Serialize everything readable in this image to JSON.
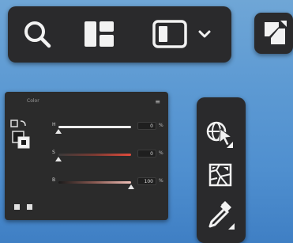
{
  "toolbar": {
    "search_icon": "search-icon",
    "layout_icon": "layout-grid-icon",
    "panel_icon": "panel-view-icon",
    "dropdown_icon": "chevron-down-icon"
  },
  "float_button": {
    "icon": "swap-color-icon"
  },
  "color_panel": {
    "title": "Color",
    "menu_glyph": "≡",
    "rows": [
      {
        "label": "H",
        "value": "0",
        "unit": "%",
        "level": 0.0
      },
      {
        "label": "S",
        "value": "0",
        "unit": "%",
        "level": 0.0
      },
      {
        "label": "B",
        "value": "100",
        "unit": "%",
        "level": 1.0
      }
    ],
    "colors": {
      "accent_red": "#e24b3c",
      "track_light": "#e8e8e8"
    }
  },
  "tool_column": {
    "tools": [
      {
        "name": "recolor-select-tool",
        "icon": "globe-cursor-icon"
      },
      {
        "name": "texture-tool",
        "icon": "crackle-texture-icon"
      },
      {
        "name": "eyedropper-tool",
        "icon": "eyedropper-icon"
      }
    ]
  }
}
